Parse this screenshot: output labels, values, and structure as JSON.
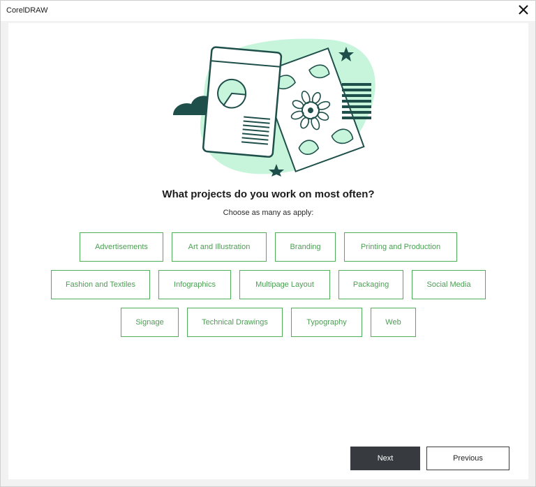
{
  "window": {
    "title": "CorelDRAW"
  },
  "prompt": {
    "heading": "What projects do you work on most often?",
    "subheading": "Choose as many as apply:"
  },
  "options": [
    "Advertisements",
    "Art and Illustration",
    "Branding",
    "Printing and Production",
    "Fashion and Textiles",
    "Infographics",
    "Multipage Layout",
    "Packaging",
    "Social Media",
    "Signage",
    "Technical Drawings",
    "Typography",
    "Web"
  ],
  "footer": {
    "next_label": "Next",
    "previous_label": "Previous"
  },
  "colors": {
    "accent_green": "#4fae57",
    "blob_mint": "#c6f5dc",
    "dark_teal": "#1f4f4a",
    "next_button_bg": "#373b3f"
  },
  "icons": {
    "close": "close-icon",
    "illustration": "projects-illustration"
  }
}
